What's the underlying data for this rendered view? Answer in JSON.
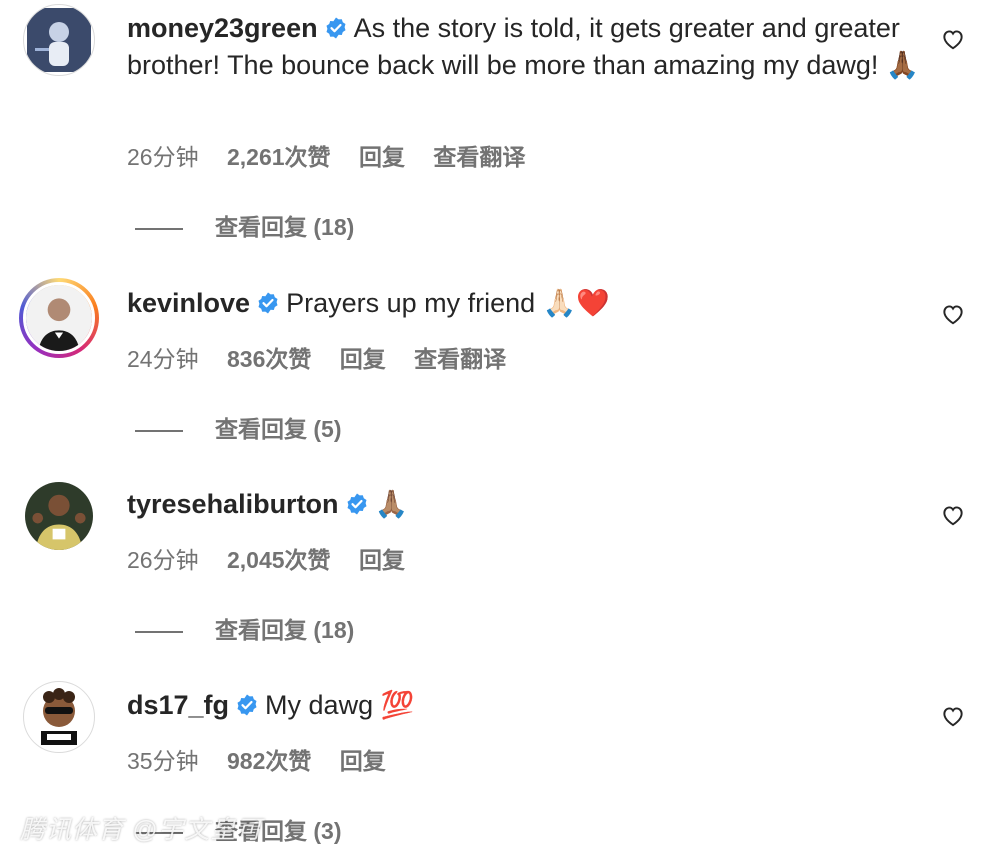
{
  "comments": [
    {
      "username": "money23green",
      "text": "As the story is told, it gets greater and greater brother! The bounce back will be more than amazing my dawg! 🙏🏾",
      "time": "26分钟",
      "likes": "2,261次赞",
      "reply": "回复",
      "translate": "查看翻译",
      "view_replies": "查看回复 (18)"
    },
    {
      "username": "kevinlove",
      "text": "Prayers up my friend 🙏🏻❤️",
      "time": "24分钟",
      "likes": "836次赞",
      "reply": "回复",
      "translate": "查看翻译",
      "view_replies": "查看回复 (5)"
    },
    {
      "username": "tyresehaliburton",
      "text": "🙏🏽",
      "time": "26分钟",
      "likes": "2,045次赞",
      "reply": "回复",
      "view_replies": "查看回复 (18)"
    },
    {
      "username": "ds17_fg",
      "text": "My dawg 💯",
      "time": "35分钟",
      "likes": "982次赞",
      "reply": "回复",
      "view_replies": "查看回复 (3)"
    }
  ],
  "watermark": "腾讯体育 @宇文皇可",
  "colors": {
    "verified": "#3897f0",
    "meta": "#737373",
    "text": "#262626"
  }
}
